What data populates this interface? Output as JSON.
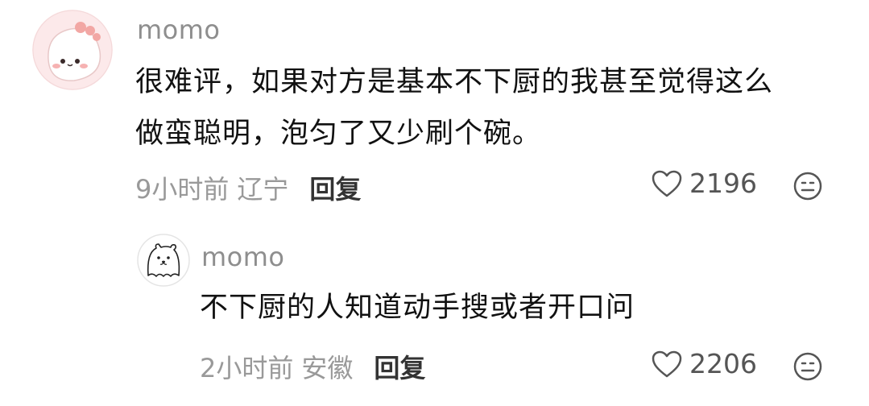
{
  "comment": {
    "username": "momo",
    "text_line1": "很难评，如果对方是基本不下厨的我甚至觉得这么",
    "text_line2": "做蛮聪明，泡匀了又少刷个碗。",
    "time": "9小时前",
    "location": "辽宁",
    "reply_label": "回复",
    "likes": "2196"
  },
  "reply": {
    "username": "momo",
    "text": "不下厨的人知道动手搜或者开口问",
    "time": "2小时前",
    "location": "安徽",
    "reply_label": "回复",
    "likes": "2206"
  }
}
